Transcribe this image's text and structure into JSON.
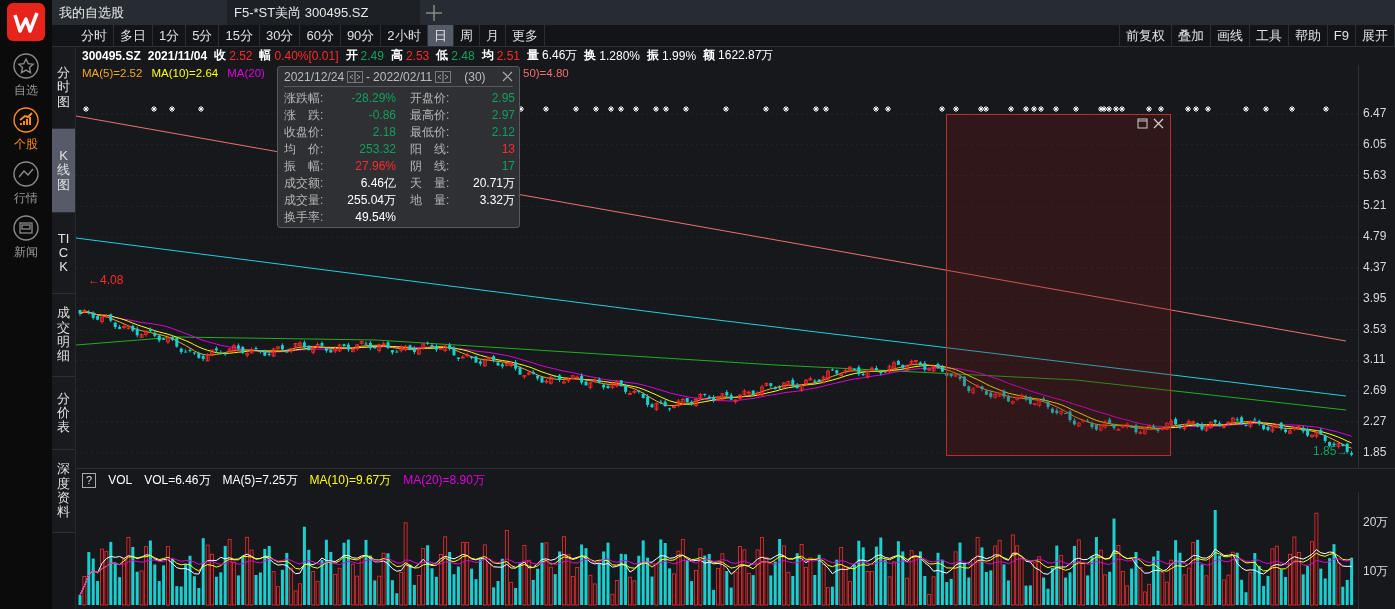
{
  "nav": {
    "items": [
      {
        "label": "自选",
        "kind": "star",
        "selected": false
      },
      {
        "label": "个股",
        "kind": "stock",
        "selected": true
      },
      {
        "label": "行情",
        "kind": "market",
        "selected": false
      },
      {
        "label": "新闻",
        "kind": "news",
        "selected": false
      }
    ]
  },
  "tabs": [
    {
      "label": "我的自选股",
      "selected": false
    },
    {
      "label": "F5-*ST美尚 300495.SZ",
      "selected": true
    }
  ],
  "periods": [
    {
      "label": "分时",
      "selected": false
    },
    {
      "label": "多日",
      "selected": false
    },
    {
      "label": "1分",
      "selected": false
    },
    {
      "label": "5分",
      "selected": false
    },
    {
      "label": "15分",
      "selected": false
    },
    {
      "label": "30分",
      "selected": false
    },
    {
      "label": "60分",
      "selected": false
    },
    {
      "label": "90分",
      "selected": false
    },
    {
      "label": "2小时",
      "selected": false
    },
    {
      "label": "日",
      "selected": true
    },
    {
      "label": "周",
      "selected": false
    },
    {
      "label": "月",
      "selected": false
    },
    {
      "label": "更多",
      "selected": false
    }
  ],
  "tools": [
    "前复权",
    "叠加",
    "画线",
    "工具",
    "帮助",
    "F9",
    "展开"
  ],
  "views": [
    {
      "label": "分时图",
      "selected": false
    },
    {
      "label": "K线图",
      "selected": true
    },
    {
      "label": "TICK",
      "selected": false
    },
    {
      "label": "成交明细",
      "selected": false
    },
    {
      "label": "分价表",
      "selected": false
    },
    {
      "label": "深度资料",
      "selected": false
    }
  ],
  "quote": {
    "code": "300495.SZ",
    "date": "2021/11/04",
    "fields": [
      {
        "label": "收",
        "value": "2.52",
        "color": "#ff2a2a"
      },
      {
        "label": "幅",
        "value": "0.40%[0.01]",
        "color": "#ff2a2a"
      },
      {
        "label": "开",
        "value": "2.49",
        "color": "#12a05c"
      },
      {
        "label": "高",
        "value": "2.53",
        "color": "#ff2a2a"
      },
      {
        "label": "低",
        "value": "2.48",
        "color": "#12a05c"
      },
      {
        "label": "均",
        "value": "2.51",
        "color": "#ff2a2a"
      },
      {
        "label": "量",
        "value": "6.46万",
        "color": "#ffffff"
      },
      {
        "label": "换",
        "value": "1.280%",
        "color": "#ffffff"
      },
      {
        "label": "振",
        "value": "1.99%",
        "color": "#ffffff"
      },
      {
        "label": "额",
        "value": "1622.87万",
        "color": "#ffffff"
      }
    ]
  },
  "ma_legend": [
    {
      "text": "MA(5)=2.52",
      "color": "#f5a623"
    },
    {
      "text": "MA(10)=2.64",
      "color": "#ffff00"
    },
    {
      "text": "MA(20)",
      "color": "#e000e0"
    },
    {
      "text": "50)=4.80",
      "color": "#f07070"
    }
  ],
  "range_popup": {
    "from": "2021/12/24",
    "separator": "-",
    "to": "2022/02/11",
    "count": "(30)",
    "rows": [
      [
        {
          "label": "涨跌幅:",
          "value": "-28.29%",
          "color": "#12a05c"
        },
        {
          "label": "开盘价:",
          "value": "2.95",
          "color": "#12a05c"
        }
      ],
      [
        {
          "label": "涨　跌:",
          "value": "-0.86",
          "color": "#12a05c"
        },
        {
          "label": "最高价:",
          "value": "2.97",
          "color": "#12a05c"
        }
      ],
      [
        {
          "label": "收盘价:",
          "value": "2.18",
          "color": "#12a05c"
        },
        {
          "label": "最低价:",
          "value": "2.12",
          "color": "#12a05c"
        }
      ],
      [
        {
          "label": "均　价:",
          "value": "253.32",
          "color": "#12a05c"
        },
        {
          "label": "阳　线:",
          "value": "13",
          "color": "#ff2a2a"
        }
      ],
      [
        {
          "label": "振　幅:",
          "value": "27.96%",
          "color": "#ff2a2a"
        },
        {
          "label": "阴　线:",
          "value": "17",
          "color": "#12a05c"
        }
      ],
      [
        {
          "label": "成交额:",
          "value": "6.46亿",
          "color": "#ffffff"
        },
        {
          "label": "天　量:",
          "value": "20.71万",
          "color": "#ffffff"
        }
      ],
      [
        {
          "label": "成交量:",
          "value": "255.04万",
          "color": "#ffffff"
        },
        {
          "label": "地　量:",
          "value": "3.32万",
          "color": "#ffffff"
        }
      ],
      [
        {
          "label": "换手率:",
          "value": "49.54%",
          "color": "#ffffff"
        }
      ]
    ]
  },
  "price_axis": [
    "6.47",
    "6.05",
    "5.63",
    "5.21",
    "4.79",
    "4.37",
    "3.95",
    "3.53",
    "3.11",
    "2.69",
    "2.27",
    "1.85"
  ],
  "high_label": "←4.08",
  "low_label": "1.85→",
  "volume": {
    "help": "?",
    "name": "VOL",
    "legend": [
      {
        "text": "VOL=6.46万",
        "color": "#ffffff"
      },
      {
        "text": "MA(5)=7.25万",
        "color": "#ffffff"
      },
      {
        "text": "MA(10)=9.67万",
        "color": "#ffff00"
      },
      {
        "text": "MA(20)=8.90万",
        "color": "#e000e0"
      }
    ],
    "axis": [
      "20万",
      "10万"
    ]
  }
}
